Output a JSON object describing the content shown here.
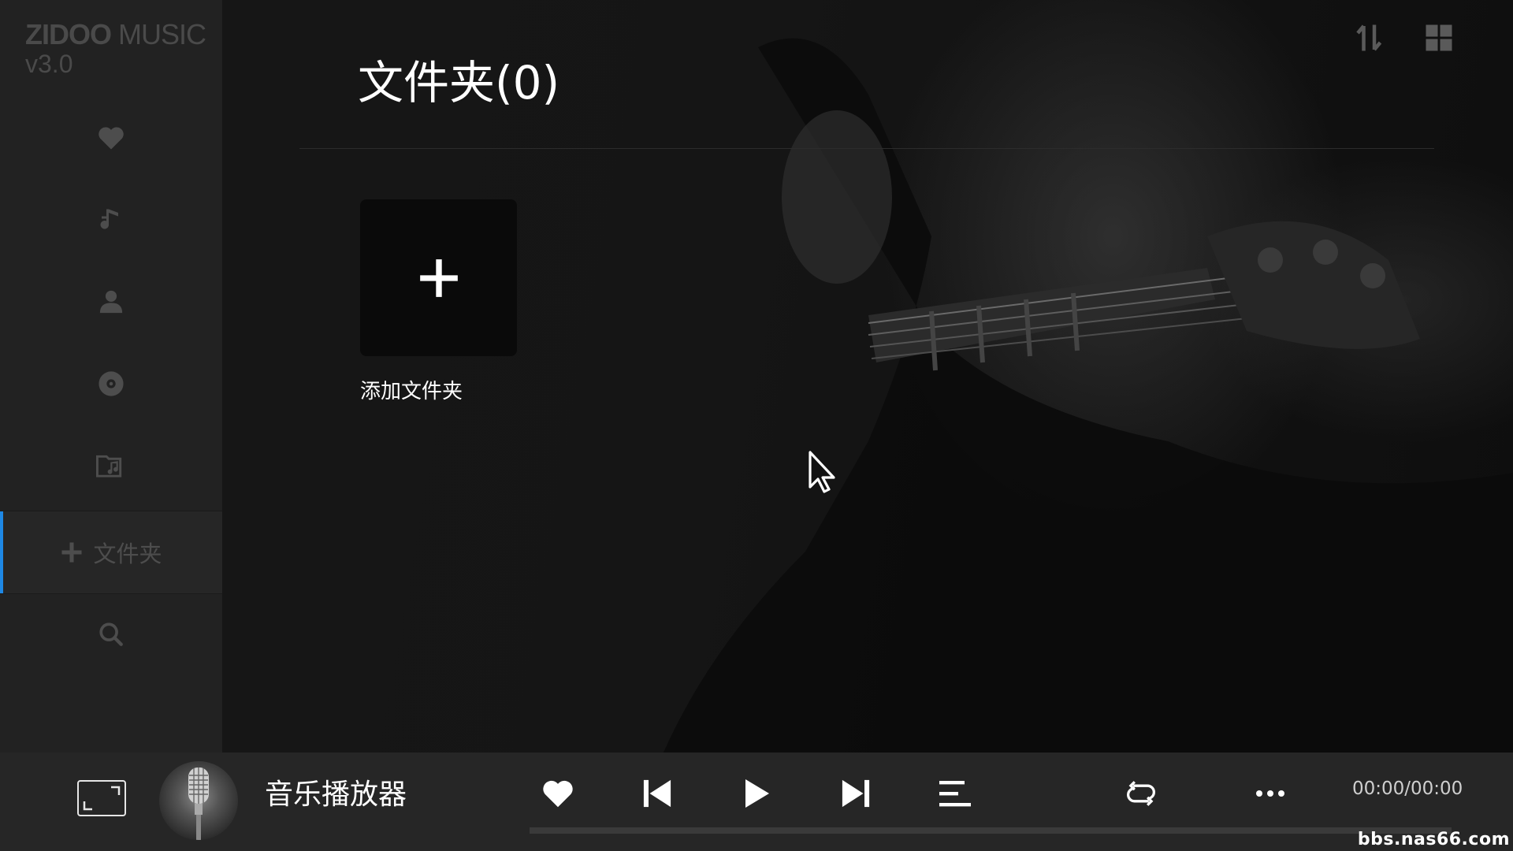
{
  "app": {
    "brand_bold": "ZIDOO",
    "brand_light": " MUSIC",
    "version": "v3.0"
  },
  "sidebar": {
    "items": [
      {
        "name": "favorites",
        "icon": "heart-icon"
      },
      {
        "name": "songs",
        "icon": "music-note-icon"
      },
      {
        "name": "artists",
        "icon": "person-icon"
      },
      {
        "name": "albums",
        "icon": "disc-icon"
      },
      {
        "name": "folders",
        "icon": "folder-music-icon"
      },
      {
        "name": "add-folder",
        "icon": "plus-icon",
        "label": "文件夹",
        "active": true
      },
      {
        "name": "search",
        "icon": "search-icon"
      }
    ]
  },
  "header": {
    "title": "文件夹(0)",
    "sort_icon": "sort-icon",
    "view_icon": "grid-view-icon"
  },
  "content": {
    "add_folder_label": "添加文件夹"
  },
  "player": {
    "track_title": "音乐播放器",
    "time": "00:00/00:00",
    "progress": 0,
    "controls": [
      "fullscreen",
      "favorite",
      "previous",
      "play",
      "next",
      "playlist",
      "repeat",
      "more"
    ]
  },
  "watermark": "bbs.nas66.com",
  "colors": {
    "accent": "#1e88e5",
    "sidebar_bg": "#222222",
    "main_bg": "#141414",
    "player_bg": "#262626",
    "icon_muted": "#4d4d4d"
  }
}
